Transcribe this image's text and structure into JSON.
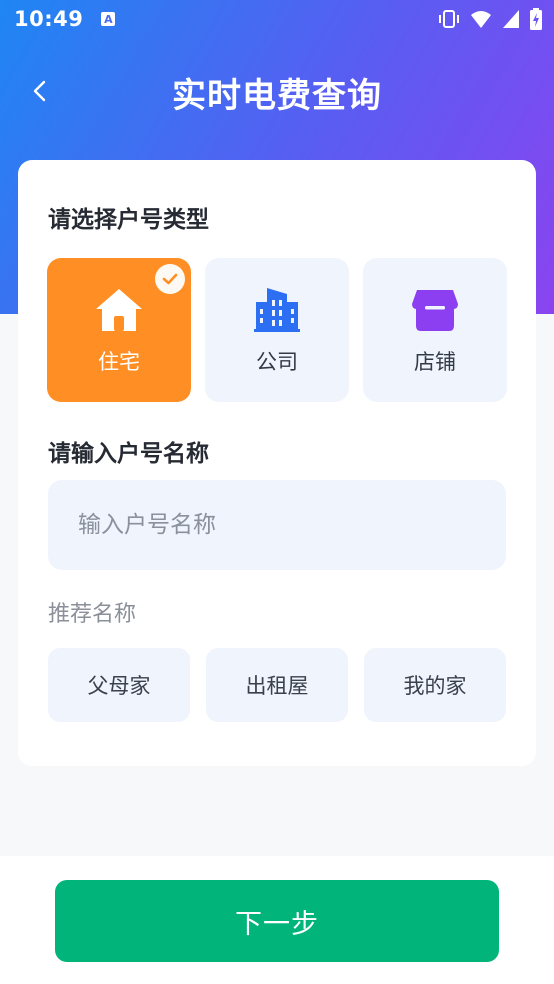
{
  "status_bar": {
    "time": "10:49",
    "notification_icon": "a-icon",
    "right_icons": [
      "vibrate-icon",
      "wifi-icon",
      "signal-icon",
      "battery-icon"
    ]
  },
  "header": {
    "back_icon": "chevron-left-icon",
    "title": "实时电费查询",
    "gradient": [
      "#1f86f3",
      "#8a44f0"
    ]
  },
  "account_type": {
    "title": "请选择户号类型",
    "options": [
      {
        "label": "住宅",
        "icon": "house-icon",
        "selected": true
      },
      {
        "label": "公司",
        "icon": "building-icon",
        "selected": false
      },
      {
        "label": "店铺",
        "icon": "shop-icon",
        "selected": false
      }
    ],
    "selected_color": "#ff8f24"
  },
  "account_name": {
    "title": "请输入户号名称",
    "value": "",
    "placeholder": "输入户号名称"
  },
  "suggestions": {
    "title": "推荐名称",
    "items": [
      "父母家",
      "出租屋",
      "我的家"
    ]
  },
  "footer": {
    "next_label": "下一步",
    "color": "#01b47a"
  }
}
